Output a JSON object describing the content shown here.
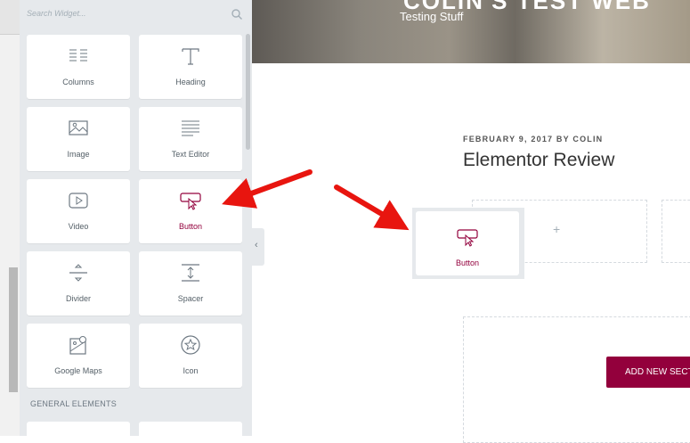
{
  "widget_panel": {
    "search_placeholder": "Search Widget...",
    "widgets": [
      {
        "label": "Columns",
        "icon": "columns-icon"
      },
      {
        "label": "Heading",
        "icon": "heading-icon"
      },
      {
        "label": "Image",
        "icon": "image-icon"
      },
      {
        "label": "Text Editor",
        "icon": "text-editor-icon"
      },
      {
        "label": "Video",
        "icon": "video-icon"
      },
      {
        "label": "Button",
        "icon": "button-icon",
        "state": "highlighted"
      },
      {
        "label": "Divider",
        "icon": "divider-icon"
      },
      {
        "label": "Spacer",
        "icon": "spacer-icon"
      },
      {
        "label": "Google Maps",
        "icon": "google-maps-icon"
      },
      {
        "label": "Icon",
        "icon": "star-icon"
      }
    ],
    "section_label": "GENERAL ELEMENTS"
  },
  "preview": {
    "site_title": "COLIN'S TEST WEB",
    "site_tagline": "Testing Stuff",
    "post_meta": "FEBRUARY 9, 2017 BY COLIN",
    "post_title": "Elementor Review",
    "drop_plus": "+",
    "dragged_widget_label": "Button",
    "add_section_label": "ADD NEW SECTION"
  },
  "colors": {
    "accent": "#93003c",
    "panel_bg": "#e6e9ec",
    "arrow": "#e8150f"
  }
}
